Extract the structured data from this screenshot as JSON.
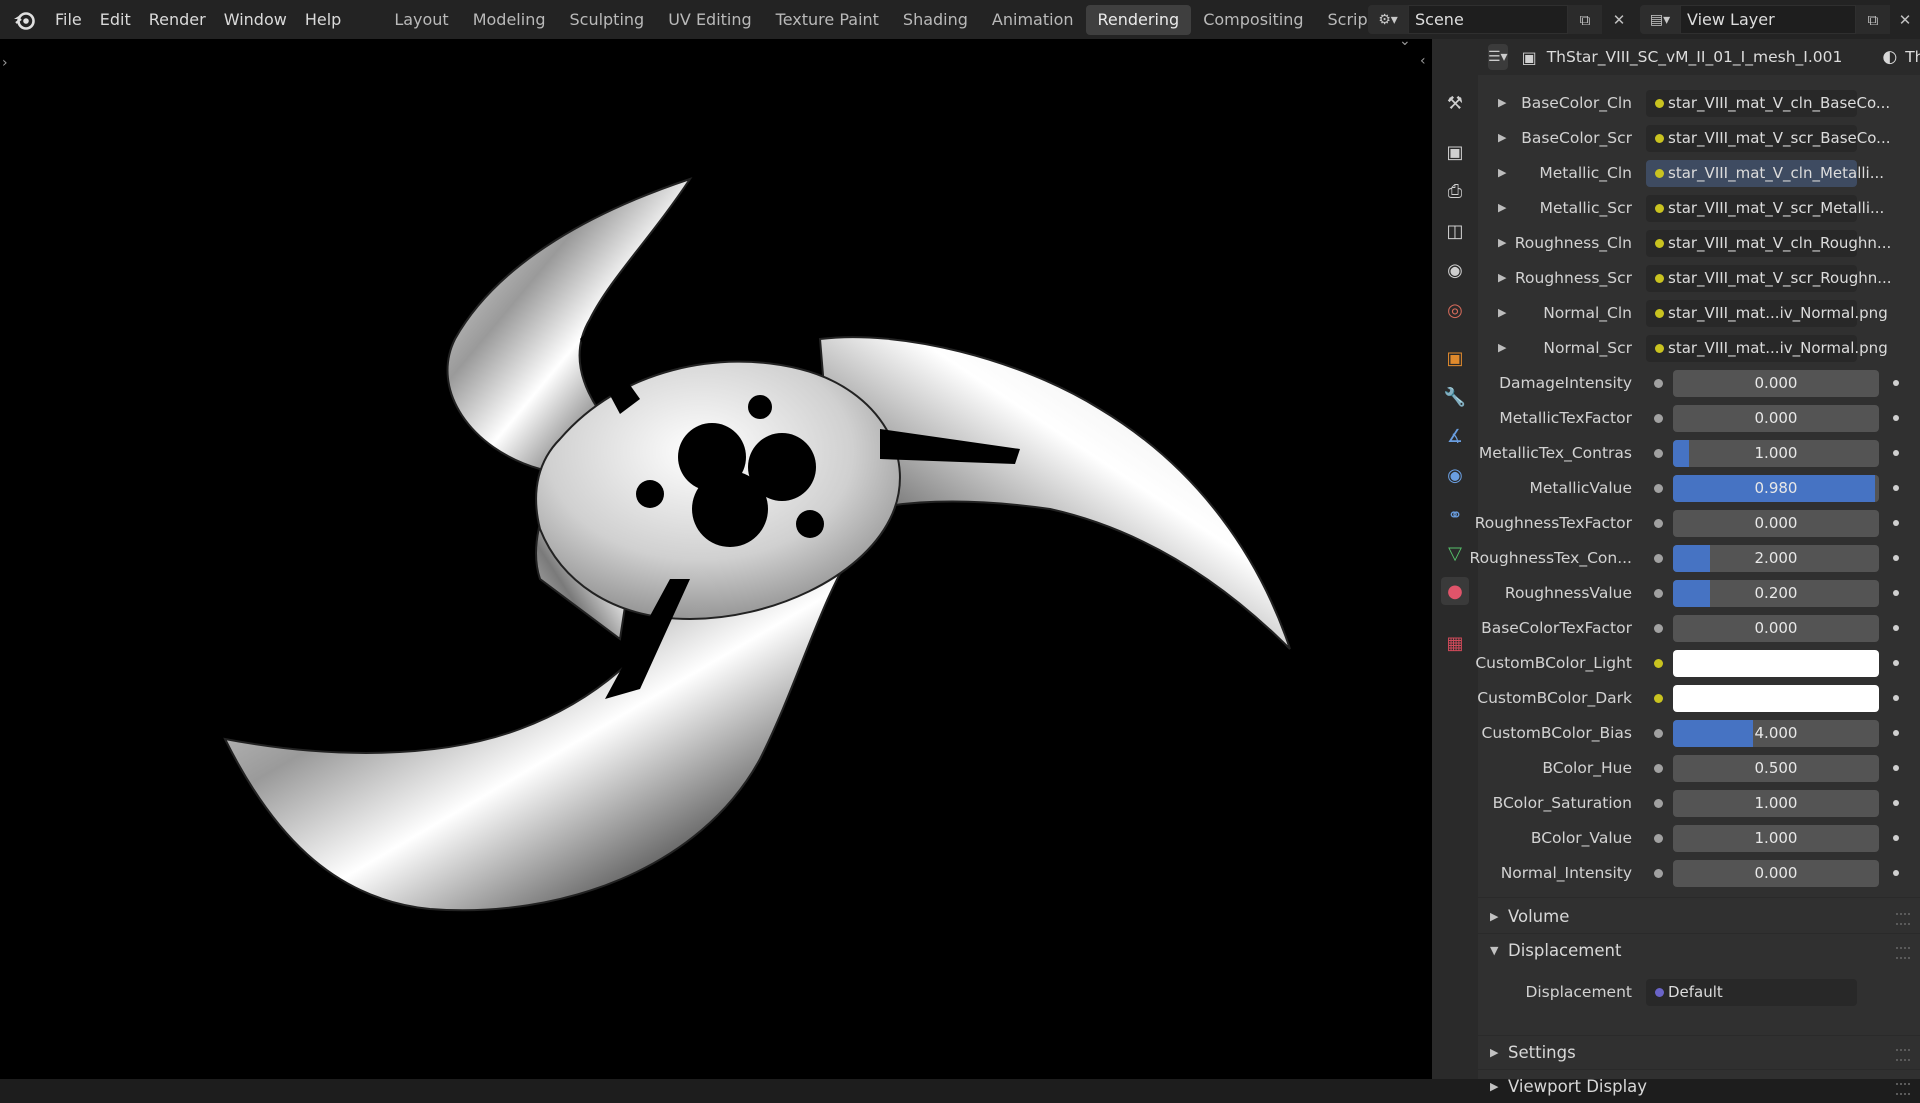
{
  "menubar": {
    "items": [
      "File",
      "Edit",
      "Render",
      "Window",
      "Help"
    ]
  },
  "workspaces": {
    "tabs": [
      "Layout",
      "Modeling",
      "Sculpting",
      "UV Editing",
      "Texture Paint",
      "Shading",
      "Animation",
      "Rendering",
      "Compositing",
      "Scripting"
    ],
    "active": "Rendering"
  },
  "scene": {
    "name": "Scene"
  },
  "view_layer": {
    "name": "View Layer"
  },
  "properties": {
    "object_name": "ThStar_VIII_SC_vM_II_01_I_mesh_I.001",
    "material_tab_name": "ThS",
    "texture_inputs": [
      {
        "label": "BaseColor_Cln",
        "value": "star_VIII_mat_V_cln_BaseCo...",
        "selected": false
      },
      {
        "label": "BaseColor_Scr",
        "value": "star_VIII_mat_V_scr_BaseCo...",
        "selected": false
      },
      {
        "label": "Metallic_Cln",
        "value": "star_VIII_mat_V_cln_Metalli...",
        "selected": true
      },
      {
        "label": "Metallic_Scr",
        "value": "star_VIII_mat_V_scr_Metalli...",
        "selected": false
      },
      {
        "label": "Roughness_Cln",
        "value": "star_VIII_mat_V_cln_Roughn...",
        "selected": false
      },
      {
        "label": "Roughness_Scr",
        "value": "star_VIII_mat_V_scr_Roughn...",
        "selected": false
      },
      {
        "label": "Normal_Cln",
        "value": "star_VIII_mat...iv_Normal.png",
        "selected": false
      },
      {
        "label": "Normal_Scr",
        "value": "star_VIII_mat...iv_Normal.png",
        "selected": false
      }
    ],
    "value_inputs": [
      {
        "label": "DamageIntensity",
        "value": "0.000",
        "fill": 0
      },
      {
        "label": "MetallicTexFactor",
        "value": "0.000",
        "fill": 0
      },
      {
        "label": "MetallicTex_Contras",
        "value": "1.000",
        "fill": 0.08
      },
      {
        "label": "MetallicValue",
        "value": "0.980",
        "fill": 0.98
      },
      {
        "label": "RoughnessTexFactor",
        "value": "0.000",
        "fill": 0
      },
      {
        "label": "RoughnessTex_Con...",
        "value": "2.000",
        "fill": 0.18
      },
      {
        "label": "RoughnessValue",
        "value": "0.200",
        "fill": 0.18
      },
      {
        "label": "BaseColorTexFactor",
        "value": "0.000",
        "fill": 0
      }
    ],
    "color_inputs": [
      {
        "label": "CustomBColor_Light",
        "color": "#ffffff"
      },
      {
        "label": "CustomBColor_Dark",
        "color": "#ffffff"
      }
    ],
    "value_inputs_2": [
      {
        "label": "CustomBColor_Bias",
        "value": "4.000",
        "fill": 0.39
      },
      {
        "label": "BColor_Hue",
        "value": "0.500",
        "fill": 0
      },
      {
        "label": "BColor_Saturation",
        "value": "1.000",
        "fill": 0
      },
      {
        "label": "BColor_Value",
        "value": "1.000",
        "fill": 0
      },
      {
        "label": "Normal_Intensity",
        "value": "0.000",
        "fill": 0
      }
    ],
    "sections": {
      "volume": "Volume",
      "displacement": "Displacement",
      "settings": "Settings",
      "viewport_display": "Viewport Display"
    },
    "displacement_row": {
      "label": "Displacement",
      "value": "Default"
    }
  },
  "colors": {
    "accent_blue": "#4673c3",
    "socket_yellow": "#c9c320",
    "socket_grey": "#a1a1a1",
    "socket_purple": "#6a64c8"
  }
}
